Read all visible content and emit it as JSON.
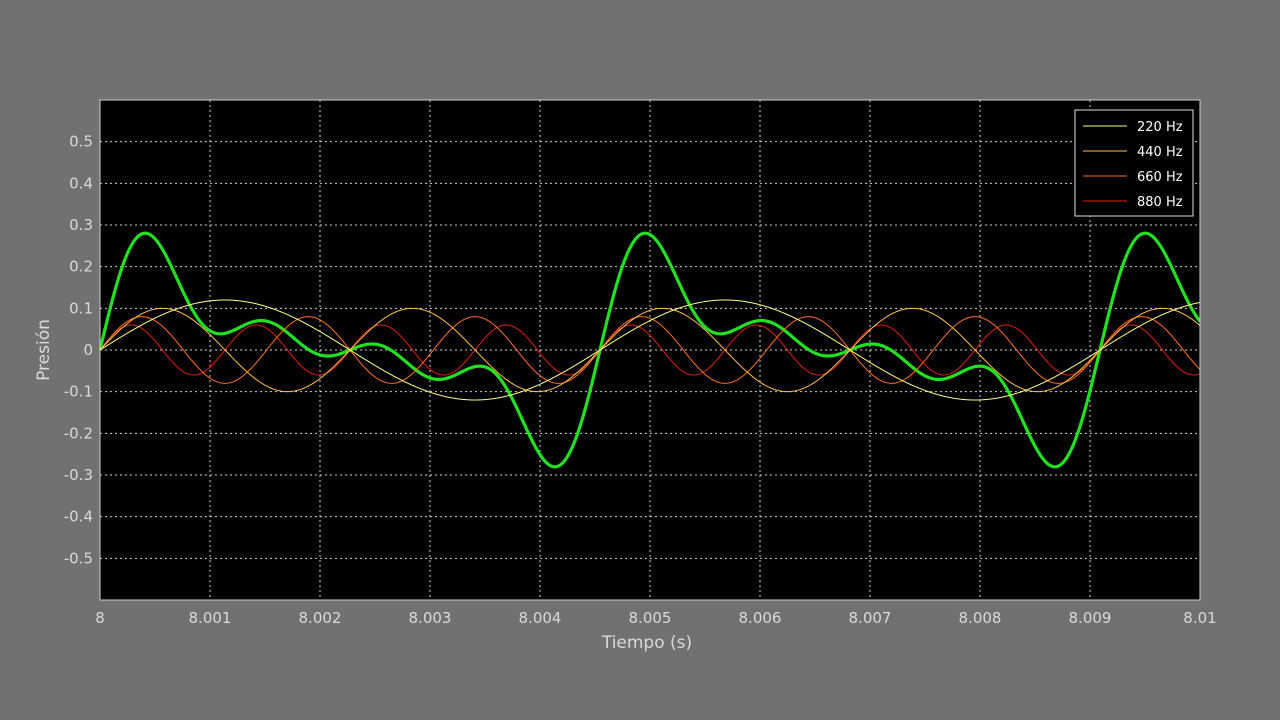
{
  "chart_data": {
    "type": "line",
    "title": "",
    "xlabel": "Tiempo (s)",
    "ylabel": "Presión",
    "xlim": [
      8,
      8.01
    ],
    "ylim": [
      -0.6,
      0.6
    ],
    "x_ticks": [
      "8",
      "8.001",
      "8.002",
      "8.003",
      "8.004",
      "8.005",
      "8.006",
      "8.007",
      "8.008",
      "8.009",
      "8.01"
    ],
    "y_ticks": [
      "0.5",
      "0.4",
      "0.3",
      "0.2",
      "0.1",
      "0",
      "-0.1",
      "-0.2",
      "-0.3",
      "-0.4",
      "-0.5"
    ],
    "grid": true,
    "legend_position": "top-right",
    "background": "#000000",
    "series": [
      {
        "name": "220 Hz",
        "frequency_hz": 220,
        "amplitude": 0.12,
        "color": "#ffff80",
        "width": 1
      },
      {
        "name": "440 Hz",
        "frequency_hz": 440,
        "amplitude": 0.1,
        "color": "#ffc040",
        "width": 1
      },
      {
        "name": "660 Hz",
        "frequency_hz": 660,
        "amplitude": 0.08,
        "color": "#ff7020",
        "width": 1
      },
      {
        "name": "880 Hz",
        "frequency_hz": 880,
        "amplitude": 0.06,
        "color": "#e02010",
        "width": 1
      },
      {
        "name": "",
        "sum_of_above": true,
        "color": "#22e022",
        "width": 3.2
      }
    ]
  }
}
